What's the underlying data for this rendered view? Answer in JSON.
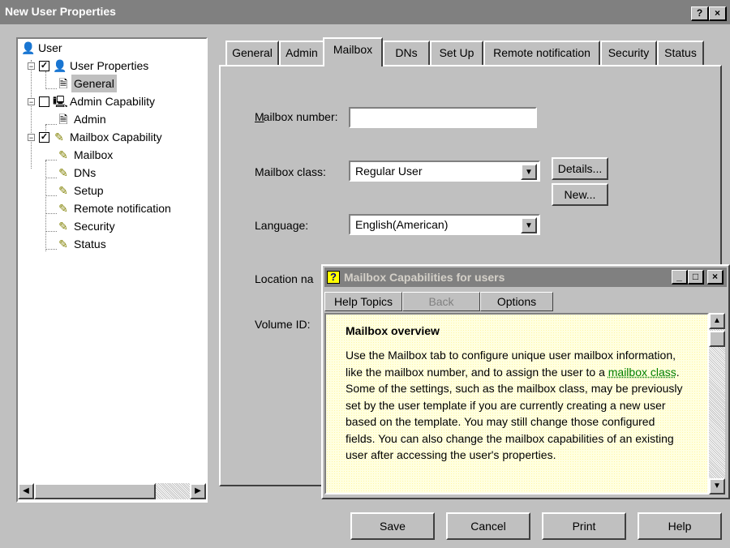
{
  "window": {
    "title": "New User Properties",
    "help_btn": "?",
    "close_btn": "×"
  },
  "tree": [
    {
      "label": "User",
      "icon": "user-icon"
    },
    {
      "label": "User Properties",
      "icon": "user-icon",
      "checked": true
    },
    {
      "label": "General",
      "icon": "document-icon",
      "selected": true
    },
    {
      "label": "Admin Capability",
      "icon": "computer-icon",
      "checked": false
    },
    {
      "label": "Admin",
      "icon": "document-icon"
    },
    {
      "label": "Mailbox Capability",
      "icon": "pencil-icon",
      "checked": true
    },
    {
      "label": "Mailbox",
      "icon": "pencil-icon"
    },
    {
      "label": "DNs",
      "icon": "pencil-icon"
    },
    {
      "label": "Setup",
      "icon": "pencil-icon"
    },
    {
      "label": "Remote notification",
      "icon": "pencil-icon"
    },
    {
      "label": "Security",
      "icon": "pencil-icon"
    },
    {
      "label": "Status",
      "icon": "pencil-icon"
    }
  ],
  "tabs": [
    "General",
    "Admin",
    "Mailbox",
    "DNs",
    "Set Up",
    "Remote notification",
    "Security",
    "Status"
  ],
  "active_tab": "Mailbox",
  "form": {
    "mailbox_number_label": "Mailbox number:",
    "mailbox_number_value": "",
    "mailbox_class_label": "Mailbox class:",
    "mailbox_class_value": "Regular User",
    "details_btn": "Details...",
    "new_btn": "New...",
    "language_label": "Language:",
    "language_value": "English(American)",
    "location_label": "Location na",
    "volume_label": "Volume ID:"
  },
  "buttons": {
    "save": "Save",
    "cancel": "Cancel",
    "print": "Print",
    "help": "Help"
  },
  "help_window": {
    "title": "Mailbox Capabilities for users",
    "help_topics": "Help Topics",
    "back": "Back",
    "options": "Options",
    "heading": "Mailbox overview",
    "text_before_link": "Use the Mailbox tab to configure unique user mailbox information, like the mailbox number, and to assign the user to a ",
    "link": "mailbox class",
    "text_after_link": ". Some of the settings, such as the mailbox class, may be previously set by the user template if you are currently creating a new user based on the template. You may still change those configured fields. You can also change the mailbox capabilities of an existing user after accessing the user's properties."
  },
  "colors": {
    "face": "#c0c0c0",
    "inactive_title": "#808080",
    "help_background": "#ffffe0",
    "link": "#008000"
  }
}
